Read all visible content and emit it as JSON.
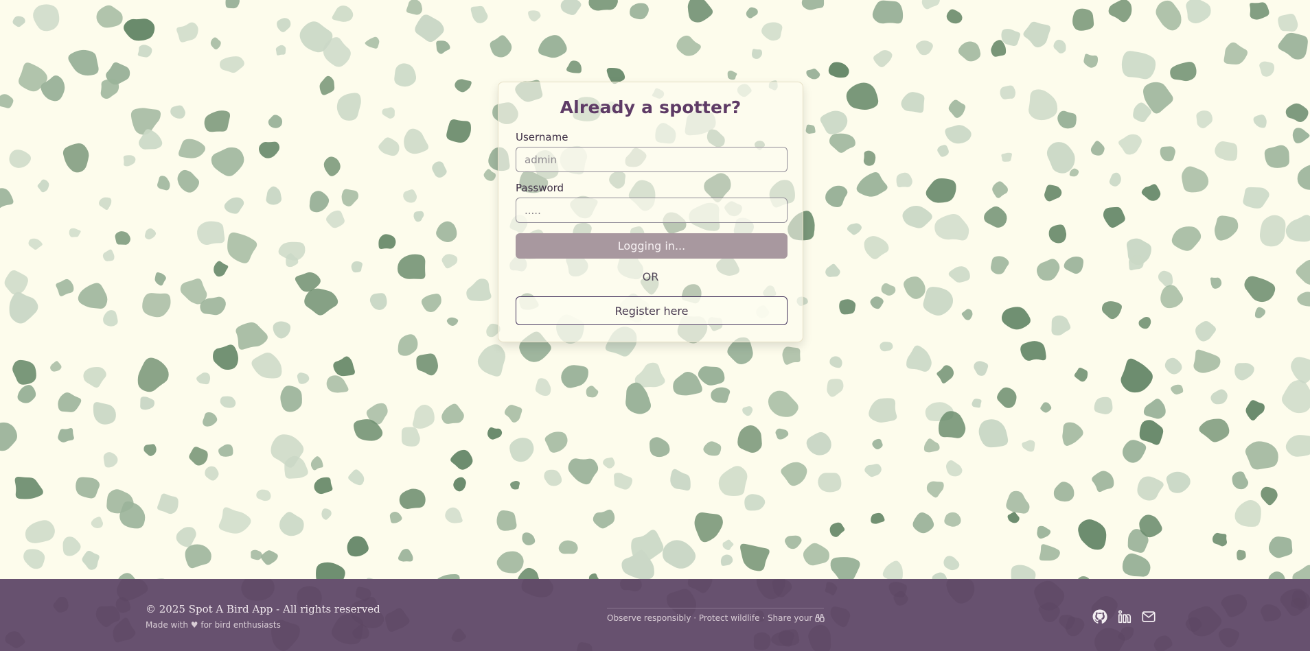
{
  "login": {
    "title": "Already a spotter?",
    "username_label": "Username",
    "username_placeholder": "admin",
    "password_label": "Password",
    "password_value": ".....",
    "login_button": "Logging in...",
    "or_text": "OR",
    "register_button": "Register here"
  },
  "footer": {
    "copyright": "© 2025 Spot A Bird App - All rights reserved",
    "made_with": "Made with ♥ for bird enthusiasts",
    "tagline": "Observe responsibly · Protect wildlife · Share your",
    "icons": [
      "github-icon",
      "linkedin-icon",
      "mail-icon",
      "binoculars-icon"
    ]
  },
  "colors": {
    "background": "#fdfcec",
    "spot_dark": "#6a8b6c",
    "spot_mid": "#9bb39a",
    "spot_light": "#cad8c6",
    "title": "#5e3b66",
    "button_disabled": "#a8989f",
    "footer": "#67516f"
  }
}
